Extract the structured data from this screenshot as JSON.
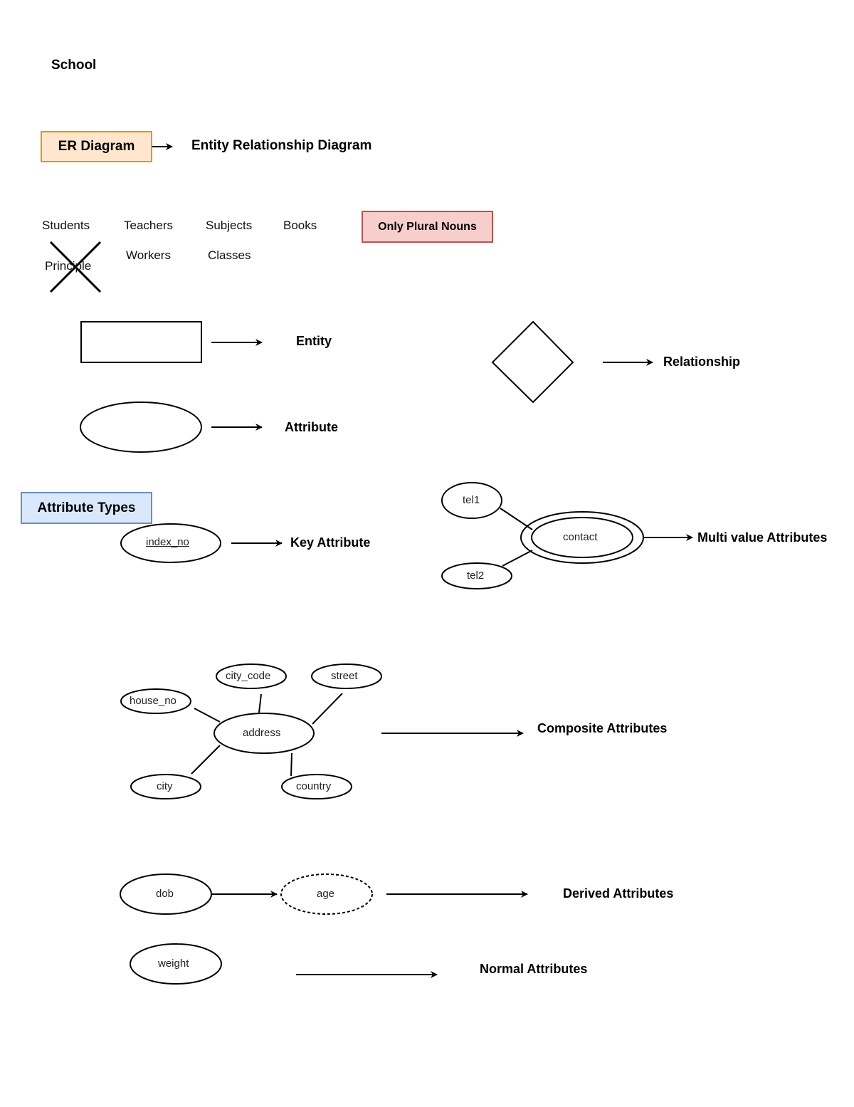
{
  "title": "School",
  "er_box": {
    "label": "ER Diagram",
    "definition": "Entity Relationship Diagram",
    "fill": "#ffe6cc",
    "border": "#d79b00"
  },
  "nouns": {
    "row1": [
      "Students",
      "Teachers",
      "Subjects",
      "Books"
    ],
    "row2": [
      "Workers",
      "Classes"
    ],
    "crossed_out": "Principle",
    "note": {
      "label": "Only Plural Nouns",
      "fill": "#f8cecc",
      "border": "#b85450"
    }
  },
  "shapes": {
    "entity_label": "Entity",
    "attribute_label": "Attribute",
    "relationship_label": "Relationship"
  },
  "attribute_types": {
    "header": {
      "label": "Attribute Types",
      "fill": "#dae8fc",
      "border": "#6c8ebf"
    },
    "key": {
      "attr": "index_no",
      "label": "Key Attribute"
    },
    "multi": {
      "main": "contact",
      "values": [
        "tel1",
        "tel2"
      ],
      "label": "Multi value Attributes"
    },
    "composite": {
      "main": "address",
      "parts": [
        "city_code",
        "street",
        "house_no",
        "city",
        "country"
      ],
      "label": "Composite Attributes"
    },
    "derived": {
      "source": "dob",
      "derived": "age",
      "label": "Derived Attributes"
    },
    "normal": {
      "attr": "weight",
      "label": "Normal Attributes"
    }
  }
}
